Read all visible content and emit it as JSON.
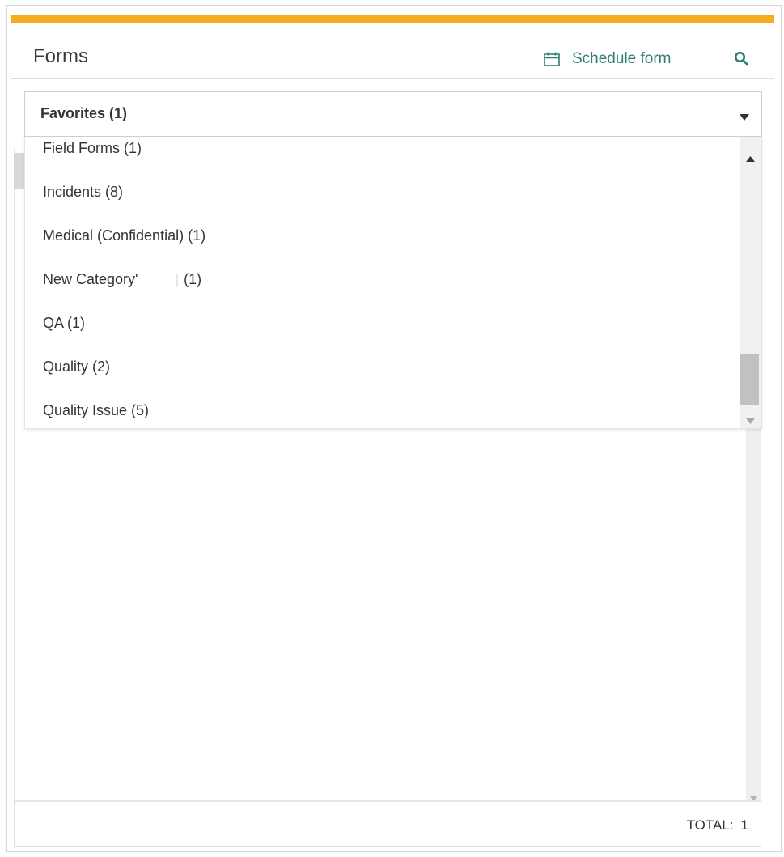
{
  "colors": {
    "accent": "#F5AD1E",
    "icon_green": "#2F7E73",
    "text": "#333333"
  },
  "header": {
    "title": "Forms",
    "schedule_label": "Schedule form",
    "schedule_icon": "calendar-icon",
    "search_icon": "search-icon"
  },
  "category_select": {
    "selected": "Favorites (1)",
    "caret_icon": "caret-down-icon"
  },
  "dropdown": {
    "items": [
      "Field Forms (1)",
      "Incidents (8)",
      "Medical (Confidential) (1)",
      "New Category'",
      "(1)",
      "QA (1)",
      "Quality (2)",
      "Quality Issue (5)"
    ]
  },
  "footer": {
    "total_label": "TOTAL:",
    "total_value": "1"
  }
}
